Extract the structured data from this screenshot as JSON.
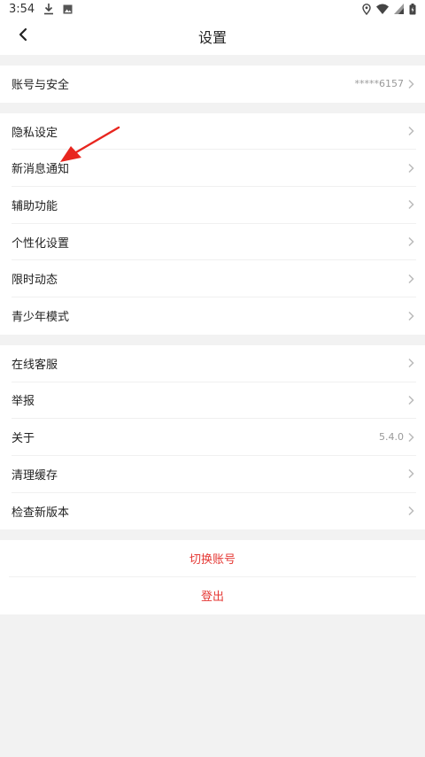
{
  "status_bar": {
    "time": "3:54",
    "icons": [
      "download-icon",
      "photo-icon",
      "location-icon",
      "wifi-icon",
      "signal-icon",
      "battery-icon"
    ]
  },
  "header": {
    "title": "设置",
    "back_icon": "chevron-left-icon"
  },
  "account_group": [
    {
      "label": "账号与安全",
      "value": "*****6157"
    }
  ],
  "privacy_group": [
    {
      "label": "隐私设定"
    },
    {
      "label": "新消息通知"
    },
    {
      "label": "辅助功能"
    },
    {
      "label": "个性化设置"
    },
    {
      "label": "限时动态"
    },
    {
      "label": "青少年模式"
    }
  ],
  "support_group": [
    {
      "label": "在线客服"
    },
    {
      "label": "举报"
    },
    {
      "label": "关于",
      "value": "5.4.0"
    },
    {
      "label": "清理缓存"
    },
    {
      "label": "检查新版本"
    }
  ],
  "actions": {
    "switch_account": "切换账号",
    "logout": "登出"
  },
  "colors": {
    "accent": "#e53935",
    "background": "#f2f2f2",
    "annotation_arrow": "#e8261f"
  }
}
